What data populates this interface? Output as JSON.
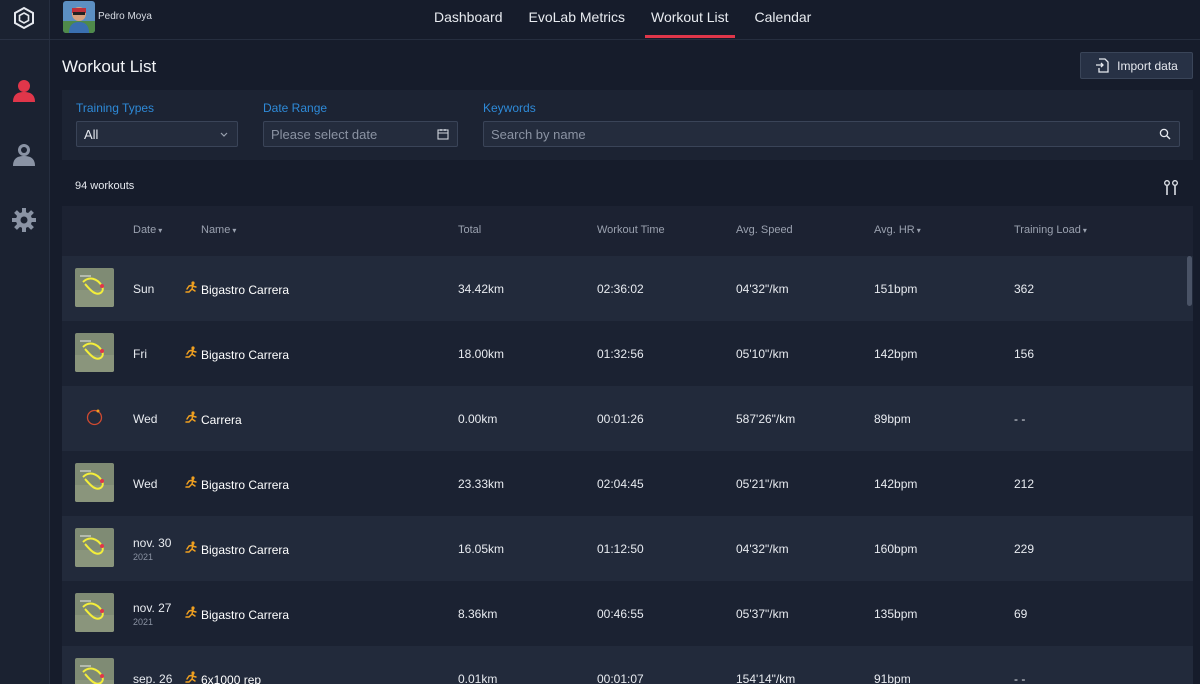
{
  "user": {
    "name": "Pedro Moya"
  },
  "nav": [
    {
      "label": "Dashboard",
      "active": false
    },
    {
      "label": "EvoLab Metrics",
      "active": false
    },
    {
      "label": "Workout List",
      "active": true
    },
    {
      "label": "Calendar",
      "active": false
    }
  ],
  "page": {
    "title": "Workout List",
    "import_label": "Import data"
  },
  "filters": {
    "training_types_label": "Training Types",
    "training_types_value": "All",
    "date_range_label": "Date Range",
    "date_range_placeholder": "Please select date",
    "keywords_label": "Keywords",
    "keywords_placeholder": "Search by name"
  },
  "list": {
    "count_text": "94 workouts"
  },
  "columns": {
    "date": "Date",
    "name": "Name",
    "total": "Total",
    "workout_time": "Workout Time",
    "avg_speed": "Avg. Speed",
    "avg_hr": "Avg. HR",
    "training_load": "Training Load"
  },
  "rows": [
    {
      "date": "Sun",
      "year": "",
      "name": "Bigastro Carrera",
      "total": "34.42km",
      "time": "02:36:02",
      "speed": "04'32\"/km",
      "hr": "151bpm",
      "load": "362",
      "thumb": "map"
    },
    {
      "date": "Fri",
      "year": "",
      "name": "Bigastro Carrera",
      "total": "18.00km",
      "time": "01:32:56",
      "speed": "05'10\"/km",
      "hr": "142bpm",
      "load": "156",
      "thumb": "map"
    },
    {
      "date": "Wed",
      "year": "",
      "name": "Carrera",
      "total": "0.00km",
      "time": "00:01:26",
      "speed": "587'26\"/km",
      "hr": "89bpm",
      "load": "- -",
      "thumb": "circle"
    },
    {
      "date": "Wed",
      "year": "",
      "name": "Bigastro Carrera",
      "total": "23.33km",
      "time": "02:04:45",
      "speed": "05'21\"/km",
      "hr": "142bpm",
      "load": "212",
      "thumb": "map"
    },
    {
      "date": "nov. 30",
      "year": "2021",
      "name": "Bigastro Carrera",
      "total": "16.05km",
      "time": "01:12:50",
      "speed": "04'32\"/km",
      "hr": "160bpm",
      "load": "229",
      "thumb": "map"
    },
    {
      "date": "nov. 27",
      "year": "2021",
      "name": "Bigastro Carrera",
      "total": "8.36km",
      "time": "00:46:55",
      "speed": "05'37\"/km",
      "hr": "135bpm",
      "load": "69",
      "thumb": "map"
    },
    {
      "date": "sep. 26",
      "year": "",
      "name": "6x1000 rep",
      "total": "0.01km",
      "time": "00:01:07",
      "speed": "154'14\"/km",
      "hr": "91bpm",
      "load": "- -",
      "thumb": "map"
    }
  ],
  "colors": {
    "accent": "#e0364a",
    "label_blue": "#2e8ad8",
    "run_icon": "#f0a020"
  }
}
